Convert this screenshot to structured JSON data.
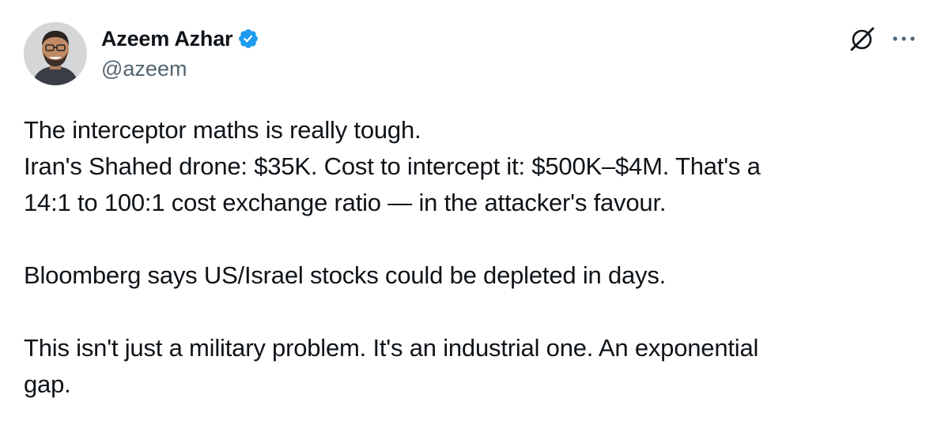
{
  "author": {
    "display_name": "Azeem Azhar",
    "handle": "@azeem",
    "verified": true
  },
  "icons": {
    "verified": "verified-badge-icon",
    "grok": "grok-icon",
    "more": "more-options-icon"
  },
  "colors": {
    "text": "#0f1419",
    "secondary_text": "#536471",
    "verified_blue": "#1d9bf0"
  },
  "tweet": {
    "paragraphs": [
      "The interceptor maths is really tough.\nIran's Shahed drone: $35K. Cost to intercept it: $500K–$4M. That's a\n14:1 to 100:1 cost exchange ratio — in the attacker's favour.",
      "Bloomberg says US/Israel stocks could be depleted in days.",
      "This isn't just a military problem. It's an industrial one. An exponential\ngap."
    ]
  }
}
